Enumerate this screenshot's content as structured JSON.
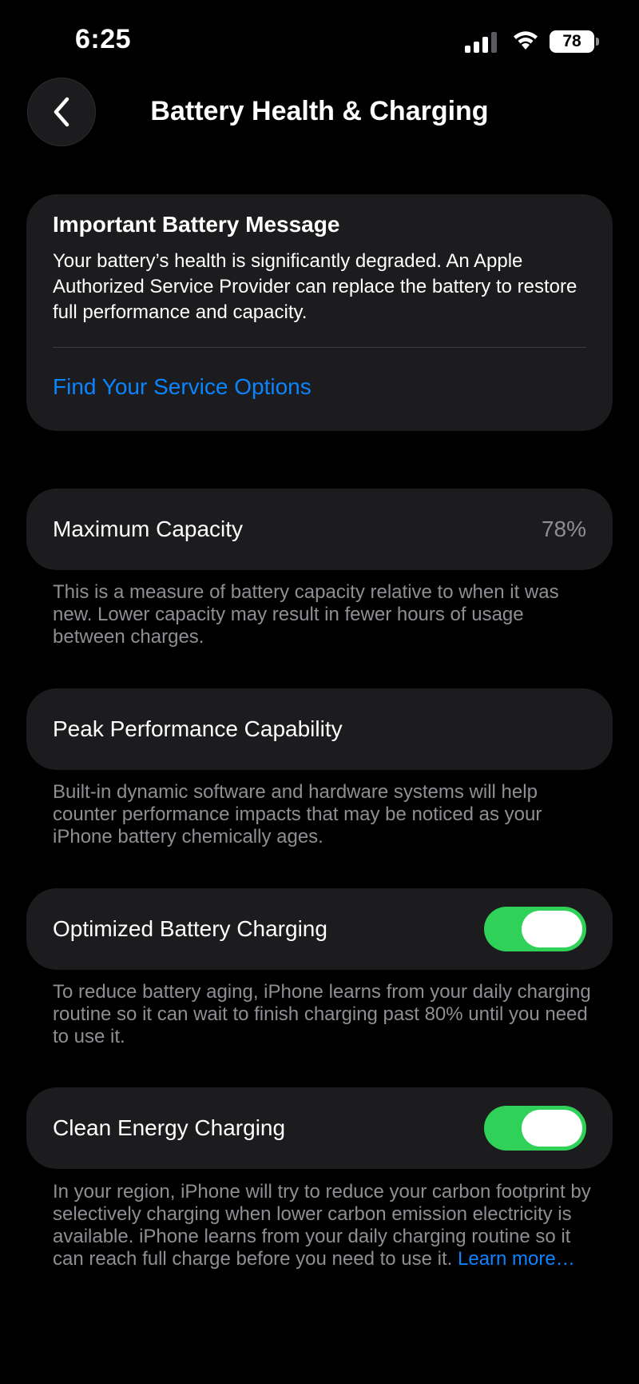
{
  "status_bar": {
    "time": "6:25",
    "battery_level": "78",
    "signal_icon": "cellular-signal-icon",
    "wifi_icon": "wifi-icon"
  },
  "nav": {
    "back_icon": "chevron-left-icon",
    "title": "Battery Health & Charging"
  },
  "battery_message": {
    "title": "Important Battery Message",
    "body": "Your battery’s health is significantly degraded. An Apple Authorized Service Provider can replace the battery to restore full performance and capacity.",
    "link": "Find Your Service Options"
  },
  "maximum_capacity": {
    "label": "Maximum Capacity",
    "value": "78%",
    "footer": "This is a measure of battery capacity relative to when it was new. Lower capacity may result in fewer hours of usage between charges."
  },
  "peak_performance": {
    "label": "Peak Performance Capability",
    "footer": "Built-in dynamic software and hardware systems will help counter performance impacts that may be noticed as your iPhone battery chemically ages."
  },
  "optimized_charging": {
    "label": "Optimized Battery Charging",
    "enabled": true,
    "footer": "To reduce battery aging, iPhone learns from your daily charging routine so it can wait to finish charging past 80% until you need to use it."
  },
  "clean_energy": {
    "label": "Clean Energy Charging",
    "enabled": true,
    "footer": "In your region, iPhone will try to reduce your carbon footprint by selectively charging when lower carbon emission electricity is available. iPhone learns from your daily charging routine so it can reach full charge before you need to use it.",
    "learn_more": "Learn more…"
  },
  "colors": {
    "background": "#000000",
    "card": "#1c1c1e",
    "link_blue": "#0a84ff",
    "toggle_green": "#30d158",
    "secondary_text": "#8e8e93"
  }
}
